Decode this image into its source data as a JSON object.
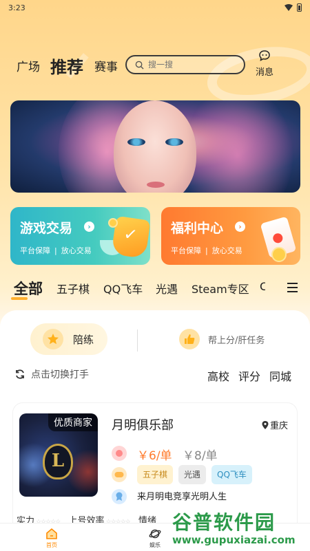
{
  "status_bar": {
    "time": "3:23"
  },
  "top_nav": {
    "tabs": [
      "广场",
      "推荐",
      "赛事"
    ],
    "search_placeholder": "搜一搜",
    "message_label": "消息"
  },
  "feature_cards": [
    {
      "title": "游戏交易",
      "sub1": "平台保障",
      "sub2": "放心交易"
    },
    {
      "title": "福利中心",
      "sub1": "平台保障",
      "sub2": "放心交易"
    }
  ],
  "category_tabs": [
    "全部",
    "五子棋",
    "QQ飞车",
    "光遇",
    "Steam专区",
    "C"
  ],
  "service_tabs": {
    "accompany": "陪练",
    "boost": "帮上分/肝任务"
  },
  "switch_label": "点击切换打手",
  "filters": [
    "高校",
    "评分",
    "同城"
  ],
  "listing": {
    "badge": "优质商家",
    "name": "月明俱乐部",
    "location": "重庆",
    "price_now": "￥6/单",
    "price_orig": "￥8/单",
    "tags": [
      "五子棋",
      "光遇",
      "QQ飞车"
    ],
    "slogan": "来月明电竞享光明人生",
    "stat_labels": [
      "实力",
      "上号效率",
      "情绪"
    ]
  },
  "bottom_nav": {
    "home": "首页",
    "fun": "娱乐"
  },
  "watermark": {
    "main": "谷普软件园",
    "sub": "www.gupuxiazai.com"
  },
  "colors": {
    "accent": "#ff8a00",
    "price": "#ff7b2c",
    "game_card": "#2fb6c9",
    "welfare_card": "#ff7a30"
  }
}
